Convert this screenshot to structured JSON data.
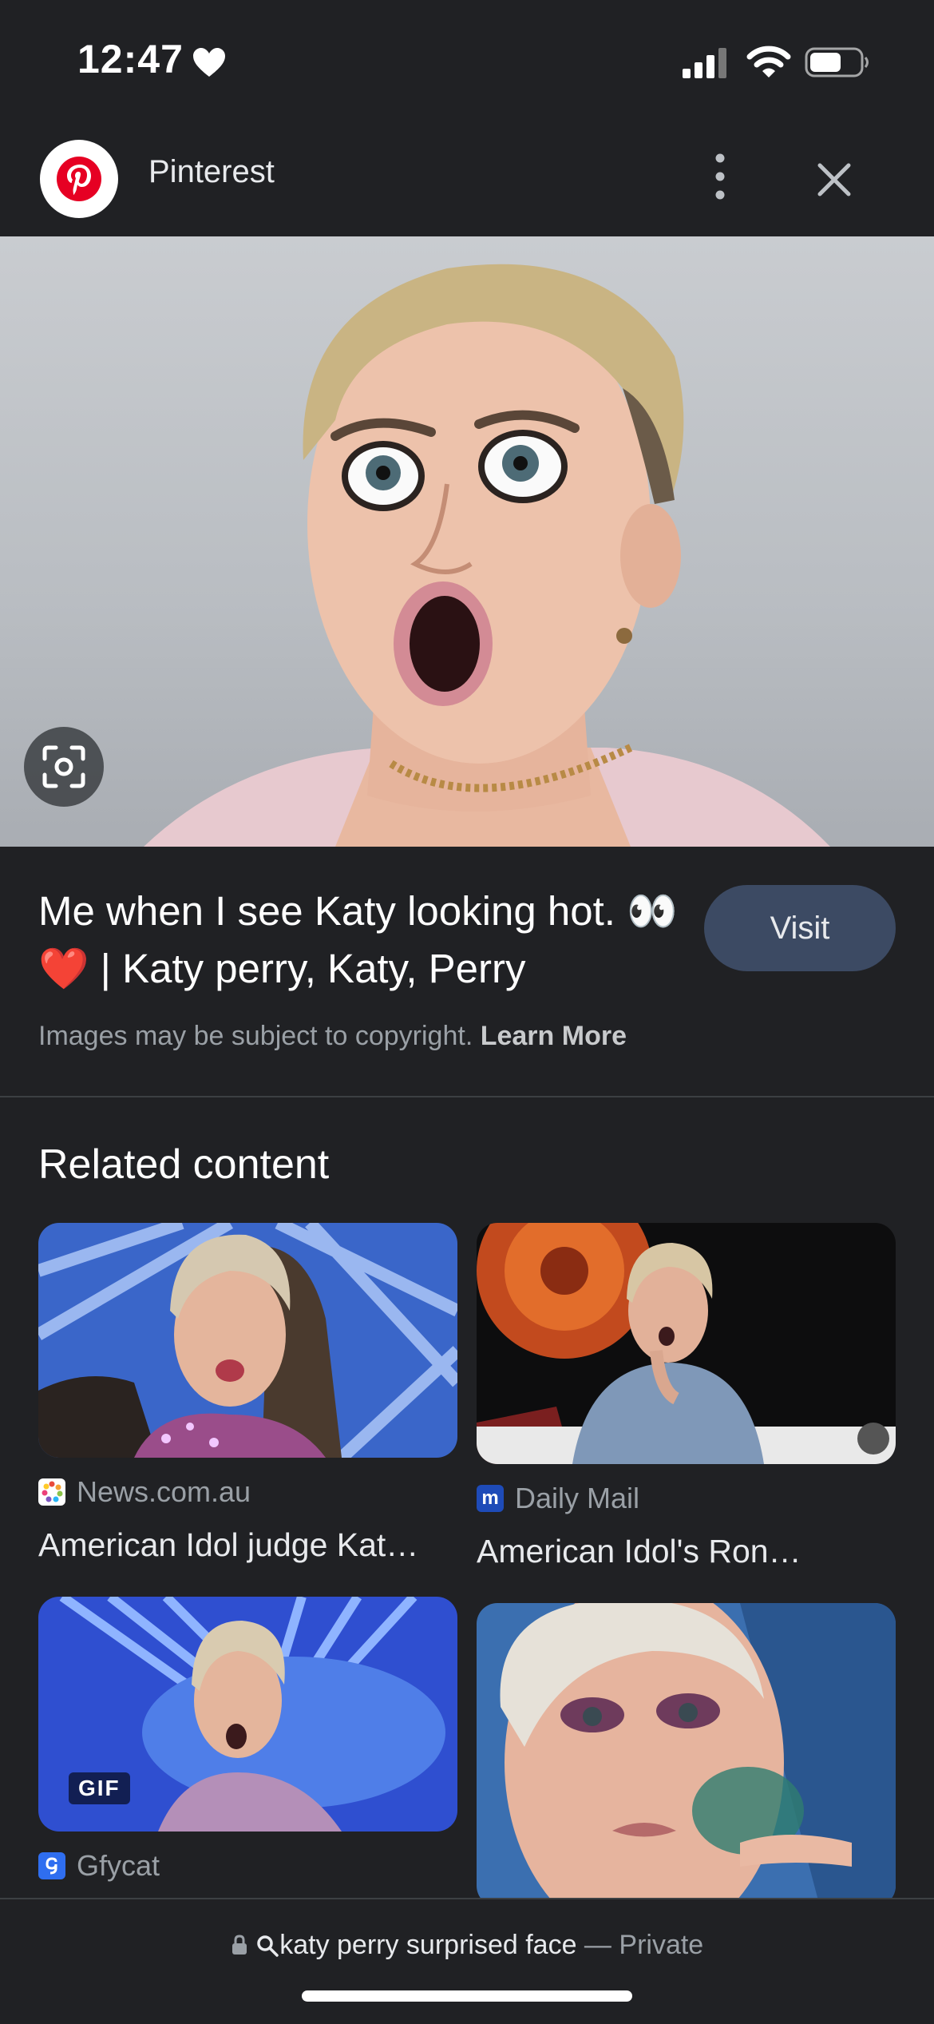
{
  "status_bar": {
    "time": "12:47",
    "battery_level": 0.6
  },
  "header": {
    "site_name": "Pinterest",
    "more_icon": "more-vert-icon",
    "close_icon": "close-icon"
  },
  "hero": {
    "lens_icon": "lens-icon"
  },
  "result": {
    "title": "Me when I see Katy looking hot. 👀❤️ | Katy perry, Katy, Perry",
    "visit_label": "Visit",
    "copyright_text": "Images may be subject to copyright.",
    "learn_more": "Learn More"
  },
  "related": {
    "heading": "Related content",
    "items": [
      {
        "source": "News.com.au",
        "title": "American Idol judge Kat…",
        "favicon_color": "#ffffff"
      },
      {
        "source": "Daily Mail",
        "title": "American Idol's Ron…",
        "favicon_color": "#1e4bb8"
      },
      {
        "source": "Gfycat",
        "title": "",
        "favicon_color": "#2f6ef0",
        "badge": "GIF"
      },
      {
        "source": "",
        "title": ""
      }
    ]
  },
  "bottom_bar": {
    "query": "katy perry surprised face",
    "separator": " — ",
    "mode": "Private"
  },
  "colors": {
    "background": "#202124",
    "visit_button": "#3c4a63",
    "pinterest_red": "#e60023"
  }
}
